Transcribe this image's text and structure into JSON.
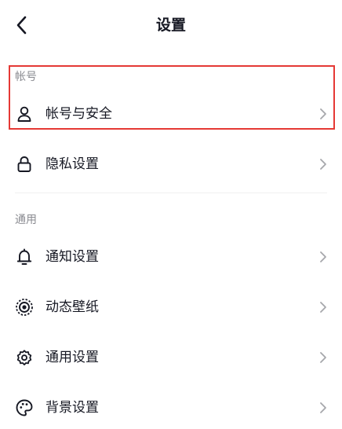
{
  "header": {
    "title": "设置",
    "back_icon": "chevron-left-icon"
  },
  "sections": [
    {
      "header": "帐号",
      "items": [
        {
          "label": "帐号与安全",
          "icon": "user-icon"
        },
        {
          "label": "隐私设置",
          "icon": "lock-icon"
        }
      ]
    },
    {
      "header": "通用",
      "items": [
        {
          "label": "通知设置",
          "icon": "bell-icon"
        },
        {
          "label": "动态壁纸",
          "icon": "live-wallpaper-icon"
        },
        {
          "label": "通用设置",
          "icon": "gear-icon"
        },
        {
          "label": "背景设置",
          "icon": "palette-icon"
        }
      ]
    }
  ],
  "colors": {
    "highlight": "#e53935",
    "text": "#161823",
    "secondary_text": "#8a8b91",
    "chevron": "#a6a7ab"
  }
}
